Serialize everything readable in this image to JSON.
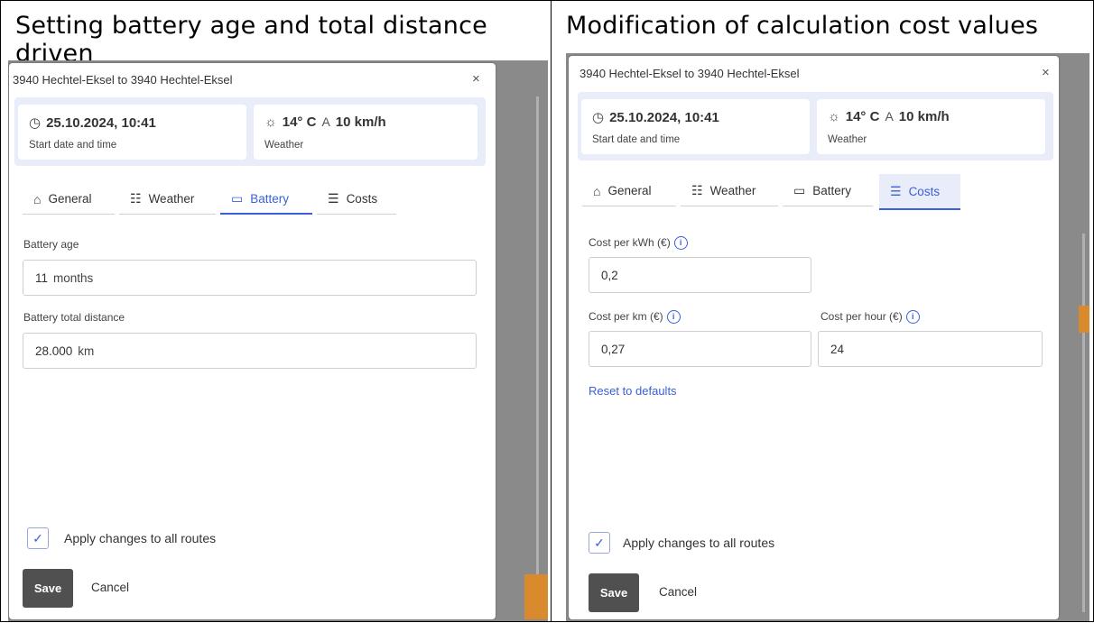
{
  "left": {
    "caption": "Setting battery age and total distance driven",
    "dialog": {
      "title": "3940 Hechtel-Eksel to 3940 Hechtel-Eksel",
      "close": "×",
      "start": {
        "icon": "clock-icon",
        "glyph": "◷",
        "value": "25.10.2024, 10:41",
        "label": "Start date and time"
      },
      "weather": {
        "icon": "sun-icon",
        "glyph": "☼",
        "temp": "14° C",
        "wind_icon": "wind-icon",
        "wind_glyph": "A",
        "wind": "10 km/h",
        "label": "Weather"
      },
      "tabs": [
        {
          "label": "General",
          "icon": "home-icon",
          "glyph": "⌂"
        },
        {
          "label": "Weather",
          "icon": "weather-icon",
          "glyph": "☷"
        },
        {
          "label": "Battery",
          "icon": "battery-icon",
          "glyph": "▭"
        },
        {
          "label": "Costs",
          "icon": "coins-icon",
          "glyph": "☰"
        }
      ],
      "active_tab": "Battery",
      "battery_age_label": "Battery age",
      "battery_age_value": "11",
      "battery_age_unit": "months",
      "battery_distance_label": "Battery total distance",
      "battery_distance_value": "28.000",
      "battery_distance_unit": "km",
      "apply_label": "Apply changes to all routes",
      "apply_checked": true,
      "save": "Save",
      "cancel": "Cancel"
    }
  },
  "right": {
    "caption": "Modification of calculation cost values",
    "dialog": {
      "title": "3940 Hechtel-Eksel to 3940 Hechtel-Eksel",
      "close": "×",
      "start": {
        "icon": "clock-icon",
        "glyph": "◷",
        "value": "25.10.2024, 10:41",
        "label": "Start date and time"
      },
      "weather": {
        "icon": "sun-icon",
        "glyph": "☼",
        "temp": "14° C",
        "wind_icon": "wind-icon",
        "wind_glyph": "A",
        "wind": "10 km/h",
        "label": "Weather"
      },
      "tabs": [
        {
          "label": "General",
          "icon": "home-icon",
          "glyph": "⌂"
        },
        {
          "label": "Weather",
          "icon": "weather-icon",
          "glyph": "☷"
        },
        {
          "label": "Battery",
          "icon": "battery-icon",
          "glyph": "▭"
        },
        {
          "label": "Costs",
          "icon": "coins-icon",
          "glyph": "☰"
        }
      ],
      "active_tab": "Costs",
      "cost_kwh_label": "Cost per kWh (€)",
      "cost_kwh_value": "0,2",
      "cost_km_label": "Cost per km (€)",
      "cost_km_value": "0,27",
      "cost_hour_label": "Cost per hour (€)",
      "cost_hour_value": "24",
      "info_glyph": "i",
      "reset_label": "Reset to defaults",
      "apply_label": "Apply changes to all routes",
      "apply_checked": true,
      "save": "Save",
      "cancel": "Cancel"
    }
  },
  "colors": {
    "accent": "#3b5fd8",
    "info_bar": "#e9edfa",
    "save_button": "#505050",
    "map_orange": "#d88a2d"
  },
  "checkmark": "✓"
}
